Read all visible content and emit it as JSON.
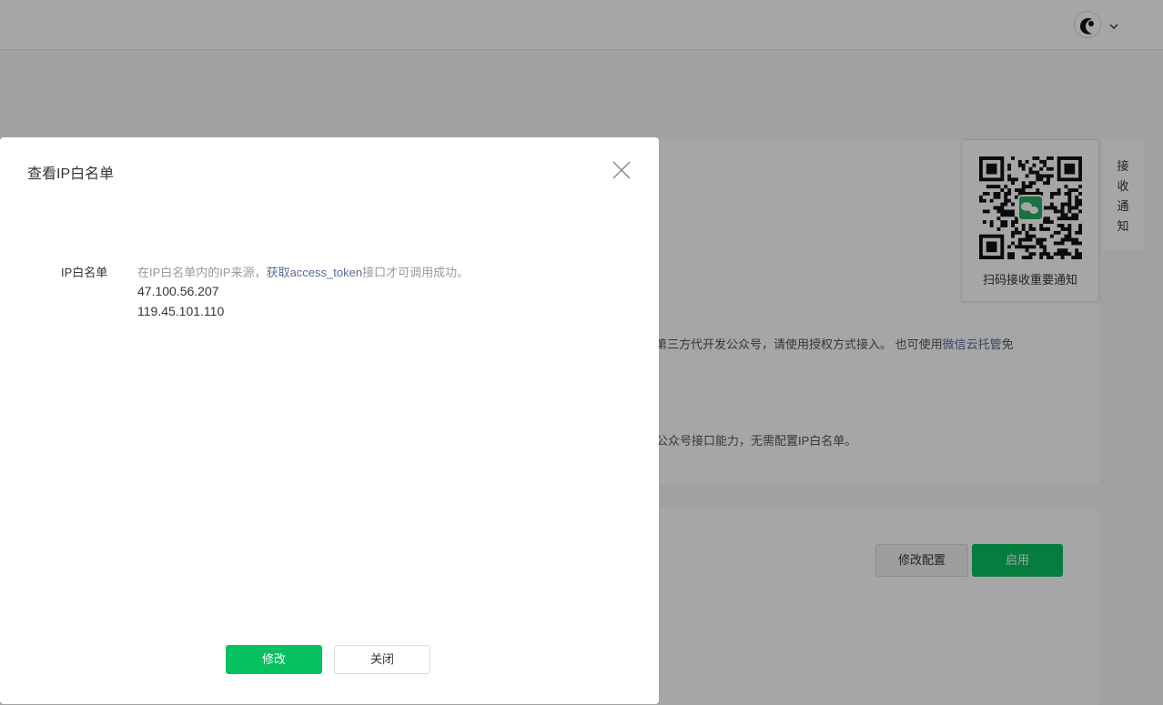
{
  "header": {
    "avatar_icon": "user-avatar",
    "menu_icon": "chevron-down-icon"
  },
  "background": {
    "line1_text": "需第三方代开发公众号，请使用授权方式接入。 也可使用",
    "line1_link": "微信云托管",
    "line1_suffix": "免",
    "line2_text": "公众号接口能力，无需配置IP白名单。",
    "modify_config_label": "修改配置",
    "enable_label": "启用",
    "qr_caption": "扫码接收重要通知",
    "notify_tab_chars": [
      "接",
      "收",
      "通",
      "知"
    ]
  },
  "dialog": {
    "title": "查看IP白名单",
    "field_label": "IP白名单",
    "tip_prefix": "在IP白名单内的IP来源，",
    "tip_link": "获取access_token",
    "tip_suffix": "接口才可调用成功。",
    "ips": [
      "47.100.56.207",
      "119.45.101.110"
    ],
    "confirm_label": "修改",
    "close_label": "关闭"
  },
  "colors": {
    "primary": "#07c160",
    "link": "#576b95",
    "mask": "rgba(0,0,0,0.35)"
  }
}
